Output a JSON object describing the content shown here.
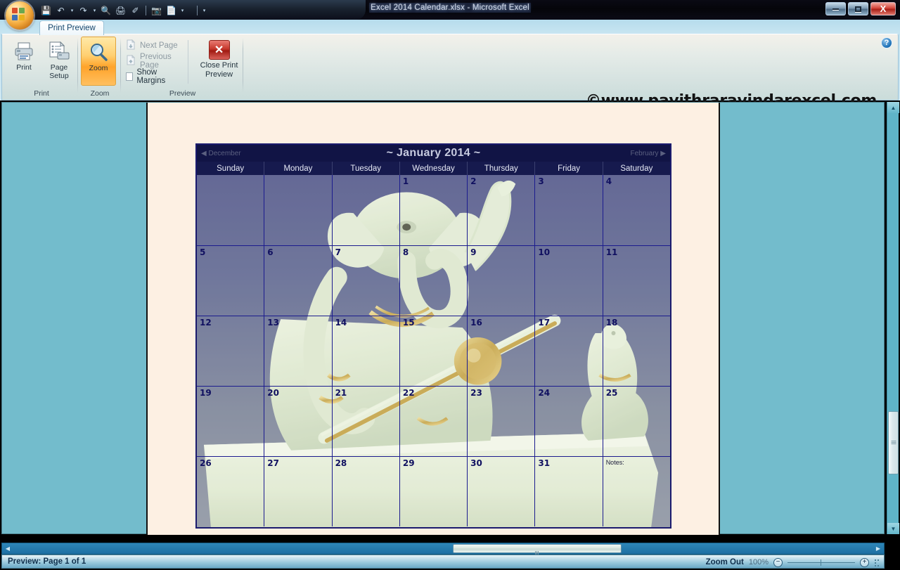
{
  "window": {
    "title": "Excel 2014 Calendar.xlsx - Microsoft Excel",
    "minimize_label": "Minimize",
    "maximize_label": "Maximize",
    "close_label": "X"
  },
  "quick_access": {
    "items": [
      {
        "name": "save-icon",
        "glyph": "💾"
      },
      {
        "name": "undo-icon",
        "glyph": "↶"
      },
      {
        "name": "undo-dropdown-icon",
        "glyph": "▾"
      },
      {
        "name": "redo-icon",
        "glyph": "↷"
      },
      {
        "name": "redo-dropdown-icon",
        "glyph": "▾"
      },
      {
        "name": "print-preview-icon",
        "glyph": "🔍"
      },
      {
        "name": "print-icon",
        "glyph": "🖨"
      },
      {
        "name": "format-painter-icon",
        "glyph": "✐"
      },
      {
        "name": "camera-icon",
        "glyph": "📷"
      },
      {
        "name": "spelling-icon",
        "glyph": "📄"
      },
      {
        "name": "spelling-dropdown-icon",
        "glyph": "▾"
      },
      {
        "name": "customize-qat-icon",
        "glyph": "▾"
      }
    ]
  },
  "ribbon": {
    "tab_label": "Print Preview",
    "help_label": "?",
    "groups": [
      {
        "id": "print",
        "label": "Print",
        "buttons": [
          {
            "label": "Print",
            "name": "print-button"
          },
          {
            "label": "Page\nSetup",
            "line1": "Page",
            "line2": "Setup",
            "name": "page-setup-button"
          }
        ]
      },
      {
        "id": "zoom",
        "label": "Zoom",
        "buttons": [
          {
            "label": "Zoom",
            "name": "zoom-button"
          }
        ]
      },
      {
        "id": "preview",
        "label": "Preview",
        "next_page": "Next Page",
        "previous_page": "Previous Page",
        "show_margins": "Show Margins",
        "close_line1": "Close Print",
        "close_line2": "Preview"
      }
    ]
  },
  "watermark": "©www.pavithraravindarexcel.com",
  "calendar": {
    "prev_month": "◀ December",
    "title": "~ January 2014 ~",
    "next_month": "February ▶",
    "day_names": [
      "Sunday",
      "Monday",
      "Tuesday",
      "Wednesday",
      "Thursday",
      "Friday",
      "Saturday"
    ],
    "notes_label": "Notes:",
    "weeks": [
      [
        "",
        "",
        "",
        "1",
        "2",
        "3",
        "4"
      ],
      [
        "5",
        "6",
        "7",
        "8",
        "9",
        "10",
        "11"
      ],
      [
        "12",
        "13",
        "14",
        "15",
        "16",
        "17",
        "18"
      ],
      [
        "19",
        "20",
        "21",
        "22",
        "23",
        "24",
        "25"
      ],
      [
        "26",
        "27",
        "28",
        "29",
        "30",
        "31",
        ""
      ]
    ]
  },
  "statusbar": {
    "status": "Preview: Page 1 of 1",
    "zoom_out": "Zoom Out",
    "zoom_percent": "100%",
    "minus": "−",
    "plus": "+"
  },
  "scrollbars": {
    "up_arrow": "▲",
    "down_arrow": "▼",
    "left_arrow": "◀",
    "right_arrow": "▶"
  }
}
